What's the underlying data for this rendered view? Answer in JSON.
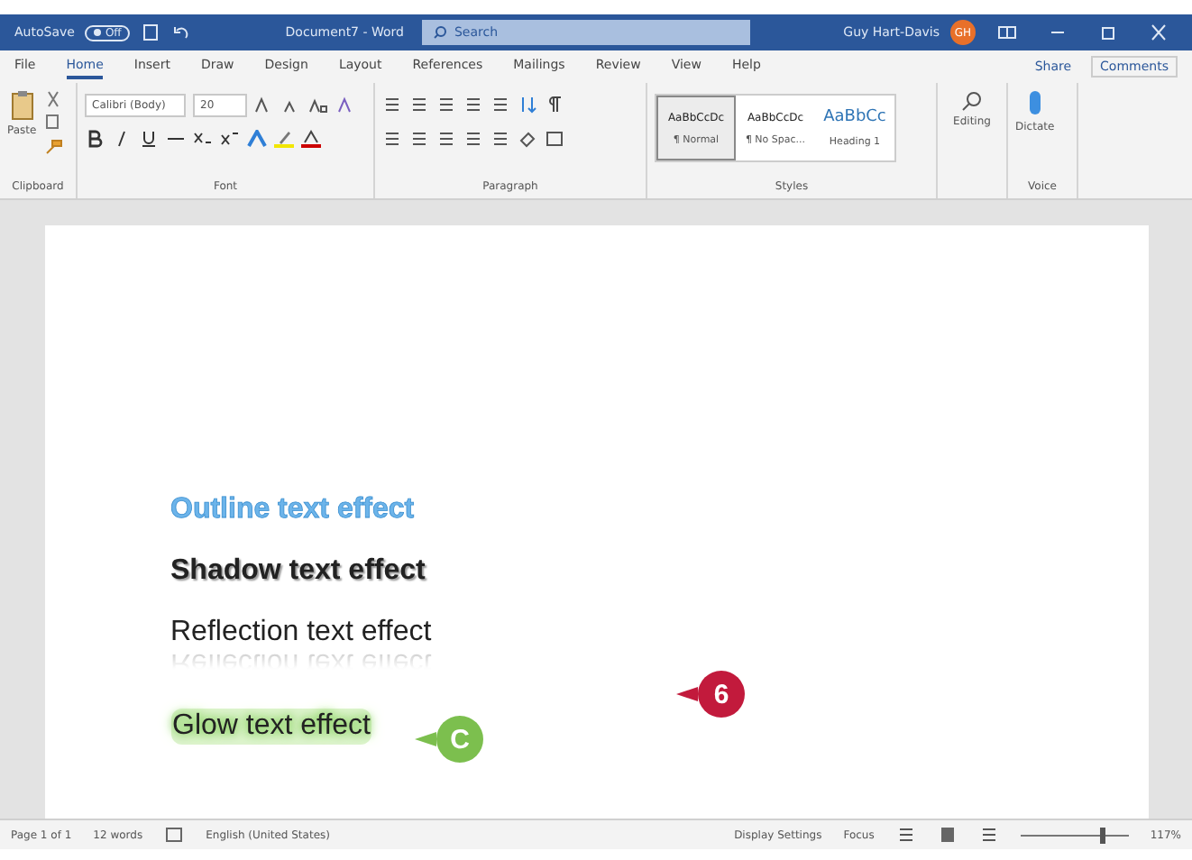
{
  "title_bar": {
    "autosave_label": "AutoSave",
    "autosave_toggle": {
      "label": "Off",
      "on": false
    },
    "document_title": "Document7 - Word",
    "search": {
      "placeholder": "Search"
    },
    "user_name": "Guy Hart-Davis",
    "initials": "GH"
  },
  "menu_tabs": [
    {
      "label": "File",
      "selected": false
    },
    {
      "label": "Home",
      "selected": true
    },
    {
      "label": "Insert",
      "selected": false
    },
    {
      "label": "Draw",
      "selected": false
    },
    {
      "label": "Design",
      "selected": false
    },
    {
      "label": "Layout",
      "selected": false
    },
    {
      "label": "References",
      "selected": false
    },
    {
      "label": "Mailings",
      "selected": false
    },
    {
      "label": "Review",
      "selected": false
    },
    {
      "label": "View",
      "selected": false
    },
    {
      "label": "Help",
      "selected": false
    }
  ],
  "share": "Share",
  "comments": "Comments",
  "ribbon": {
    "paste": "Paste",
    "font_name": "Calibri (Body)",
    "font_size": "20",
    "styles": [
      {
        "preview": "AaBbCcDc",
        "name": "¶ Normal",
        "selected": true
      },
      {
        "preview": "AaBbCcDc",
        "name": "¶ No Spac...",
        "selected": false
      },
      {
        "preview": "AaBbCc",
        "name": "Heading 1",
        "selected": false
      }
    ],
    "editing": "Editing",
    "dictate": "Dictate",
    "groups": [
      "Clipboard",
      "Font",
      "Paragraph",
      "Styles",
      "Voice"
    ]
  },
  "document_lines": [
    {
      "kind": "outline",
      "text": "Outline text effect"
    },
    {
      "kind": "shadow",
      "text": "Shadow text effect"
    },
    {
      "kind": "reflection",
      "text": "Reflection text effect"
    },
    {
      "kind": "glow",
      "text": "Glow text effect"
    }
  ],
  "callouts": [
    {
      "label": "6",
      "color": "#c21a3c"
    },
    {
      "label": "C",
      "color": "#7cbf4e"
    }
  ],
  "status_bar": {
    "page": "Page 1 of 1",
    "words": "12 words",
    "language": "English (United States)",
    "display_settings": "Display Settings",
    "focus": "Focus",
    "zoom_slider": {
      "level": 0.75
    },
    "zoom": "117%"
  }
}
